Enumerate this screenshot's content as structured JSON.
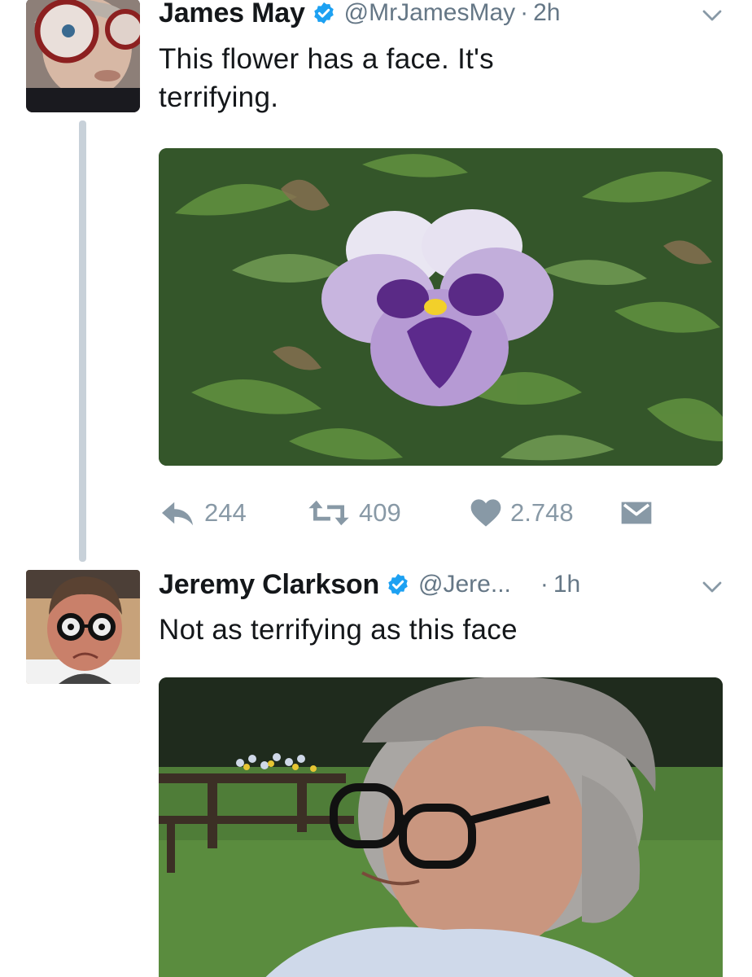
{
  "tweet1": {
    "name": "James May",
    "handle": "@MrJamesMay",
    "separator": "·",
    "time": "2h",
    "text_line1": "This flower has a face. It's",
    "text_line2": "terrifying.",
    "avatar_icon": "avatar-photo-icon",
    "media_icon": "flower-photo"
  },
  "actions": {
    "reply_count": "244",
    "retweet_count": "409",
    "like_count": "2.748"
  },
  "tweet2": {
    "name": "Jeremy Clarkson",
    "handle": "@Jere...",
    "separator": "·",
    "time": "1h",
    "text": "Not as terrifying as this face",
    "avatar_icon": "avatar-photo-icon",
    "media_icon": "face-photo"
  },
  "colors": {
    "verified_blue": "#1da1f2",
    "muted_gray": "#8899a6",
    "thread_line": "#c8d1d9"
  }
}
